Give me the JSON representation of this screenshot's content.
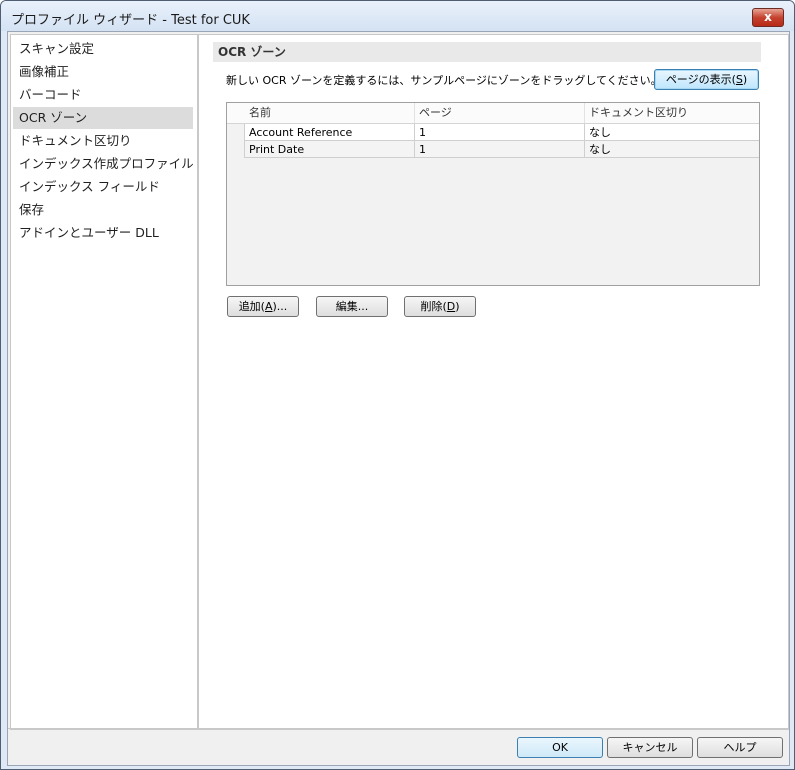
{
  "window": {
    "title": "プロファイル ウィザード - Test for CUK",
    "close_label": "x"
  },
  "nav": {
    "items": [
      {
        "label": "スキャン設定"
      },
      {
        "label": "画像補正"
      },
      {
        "label": "バーコード"
      },
      {
        "label": "OCR ゾーン",
        "selected": true
      },
      {
        "label": "ドキュメント区切り"
      },
      {
        "label": "インデックス作成プロファイル"
      },
      {
        "label": "インデックス フィールド"
      },
      {
        "label": "保存"
      },
      {
        "label": "アドインとユーザー DLL"
      }
    ]
  },
  "main": {
    "section_title": "OCR ゾーン",
    "instruction": "新しい OCR ゾーンを定義するには、サンプルページにゾーンをドラッグしてください。",
    "show_page_button": {
      "label": "ページの表示(",
      "mnemonic": "S",
      "suffix": ")"
    },
    "table": {
      "columns": [
        "名前",
        "ページ",
        "ドキュメント区切り"
      ],
      "rows": [
        [
          "Account Reference",
          "1",
          "なし"
        ],
        [
          "Print Date",
          "1",
          "なし"
        ]
      ]
    },
    "actions": {
      "add": {
        "label": "追加(",
        "mnemonic": "A",
        "suffix": ")..."
      },
      "edit": {
        "label": "編集..."
      },
      "delete": {
        "label": "削除(",
        "mnemonic": "D",
        "suffix": ")"
      }
    }
  },
  "footer": {
    "ok": "OK",
    "cancel": "キャンセル",
    "help": "ヘルプ"
  }
}
